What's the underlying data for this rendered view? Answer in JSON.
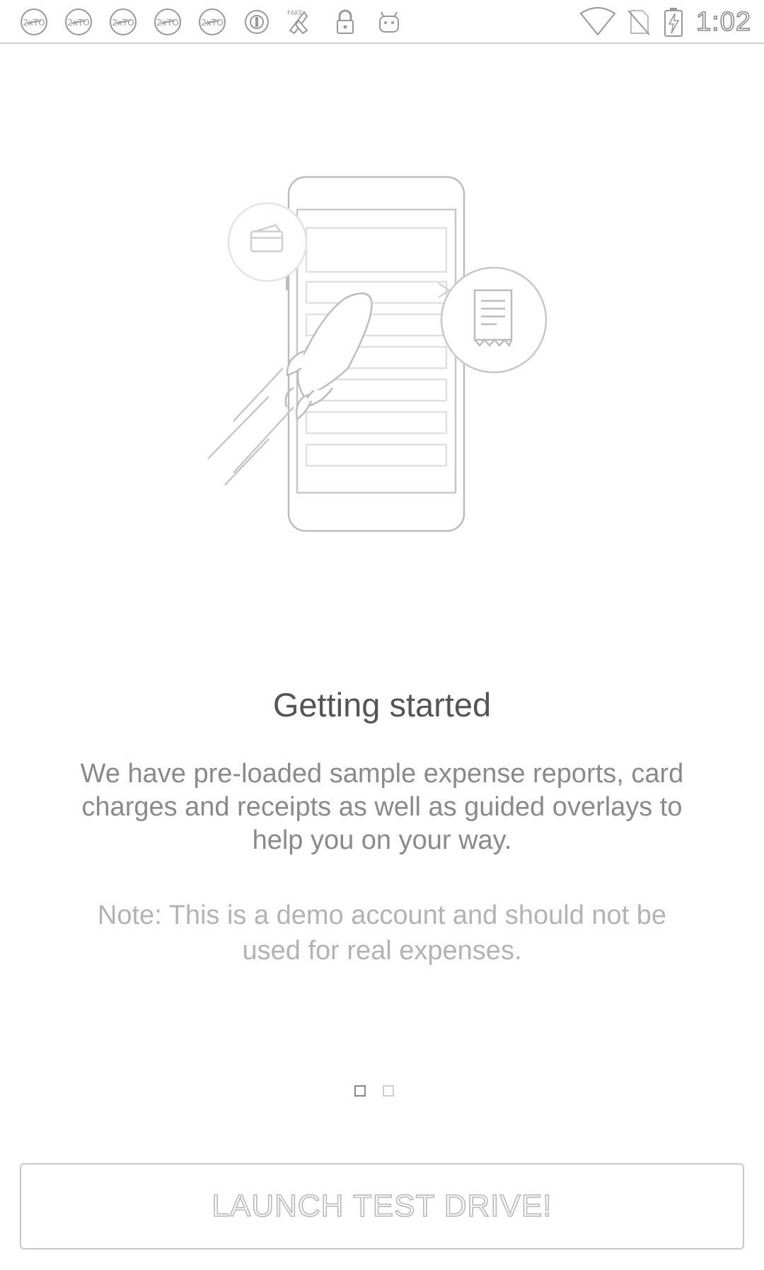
{
  "status_bar": {
    "time": "1:02",
    "left_icons": [
      "2xto-icon",
      "2xto-icon",
      "2xto-icon",
      "2xto-icon",
      "2xto-icon",
      "circle-badge-icon",
      "fake-gps-icon",
      "lock-icon",
      "android-robot-icon"
    ],
    "right_icons": [
      "wifi-icon",
      "no-sim-icon",
      "battery-charging-icon"
    ]
  },
  "onboarding": {
    "title": "Getting started",
    "description": "We have pre-loaded sample expense reports, card charges and receipts as well as guided overlays to help you on your way.",
    "note": "Note: This is a demo account and should not be used for real expenses.",
    "page_index": 1,
    "page_count": 2
  },
  "footer": {
    "launch_label": "LAUNCH TEST DRIVE!"
  }
}
